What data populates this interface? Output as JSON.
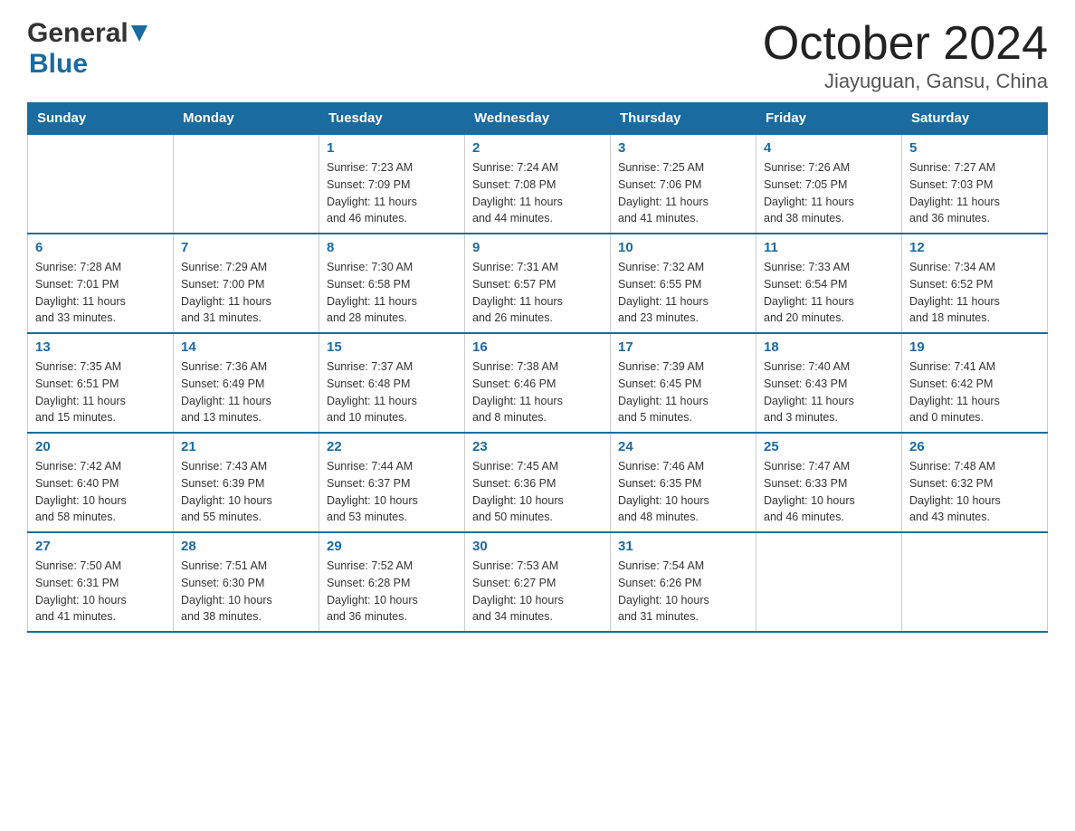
{
  "header": {
    "logo": {
      "general_text": "General",
      "blue_text": "Blue"
    },
    "title": "October 2024",
    "location": "Jiayuguan, Gansu, China"
  },
  "calendar": {
    "days_of_week": [
      "Sunday",
      "Monday",
      "Tuesday",
      "Wednesday",
      "Thursday",
      "Friday",
      "Saturday"
    ],
    "weeks": [
      [
        {
          "day": "",
          "info": ""
        },
        {
          "day": "",
          "info": ""
        },
        {
          "day": "1",
          "info": "Sunrise: 7:23 AM\nSunset: 7:09 PM\nDaylight: 11 hours\nand 46 minutes."
        },
        {
          "day": "2",
          "info": "Sunrise: 7:24 AM\nSunset: 7:08 PM\nDaylight: 11 hours\nand 44 minutes."
        },
        {
          "day": "3",
          "info": "Sunrise: 7:25 AM\nSunset: 7:06 PM\nDaylight: 11 hours\nand 41 minutes."
        },
        {
          "day": "4",
          "info": "Sunrise: 7:26 AM\nSunset: 7:05 PM\nDaylight: 11 hours\nand 38 minutes."
        },
        {
          "day": "5",
          "info": "Sunrise: 7:27 AM\nSunset: 7:03 PM\nDaylight: 11 hours\nand 36 minutes."
        }
      ],
      [
        {
          "day": "6",
          "info": "Sunrise: 7:28 AM\nSunset: 7:01 PM\nDaylight: 11 hours\nand 33 minutes."
        },
        {
          "day": "7",
          "info": "Sunrise: 7:29 AM\nSunset: 7:00 PM\nDaylight: 11 hours\nand 31 minutes."
        },
        {
          "day": "8",
          "info": "Sunrise: 7:30 AM\nSunset: 6:58 PM\nDaylight: 11 hours\nand 28 minutes."
        },
        {
          "day": "9",
          "info": "Sunrise: 7:31 AM\nSunset: 6:57 PM\nDaylight: 11 hours\nand 26 minutes."
        },
        {
          "day": "10",
          "info": "Sunrise: 7:32 AM\nSunset: 6:55 PM\nDaylight: 11 hours\nand 23 minutes."
        },
        {
          "day": "11",
          "info": "Sunrise: 7:33 AM\nSunset: 6:54 PM\nDaylight: 11 hours\nand 20 minutes."
        },
        {
          "day": "12",
          "info": "Sunrise: 7:34 AM\nSunset: 6:52 PM\nDaylight: 11 hours\nand 18 minutes."
        }
      ],
      [
        {
          "day": "13",
          "info": "Sunrise: 7:35 AM\nSunset: 6:51 PM\nDaylight: 11 hours\nand 15 minutes."
        },
        {
          "day": "14",
          "info": "Sunrise: 7:36 AM\nSunset: 6:49 PM\nDaylight: 11 hours\nand 13 minutes."
        },
        {
          "day": "15",
          "info": "Sunrise: 7:37 AM\nSunset: 6:48 PM\nDaylight: 11 hours\nand 10 minutes."
        },
        {
          "day": "16",
          "info": "Sunrise: 7:38 AM\nSunset: 6:46 PM\nDaylight: 11 hours\nand 8 minutes."
        },
        {
          "day": "17",
          "info": "Sunrise: 7:39 AM\nSunset: 6:45 PM\nDaylight: 11 hours\nand 5 minutes."
        },
        {
          "day": "18",
          "info": "Sunrise: 7:40 AM\nSunset: 6:43 PM\nDaylight: 11 hours\nand 3 minutes."
        },
        {
          "day": "19",
          "info": "Sunrise: 7:41 AM\nSunset: 6:42 PM\nDaylight: 11 hours\nand 0 minutes."
        }
      ],
      [
        {
          "day": "20",
          "info": "Sunrise: 7:42 AM\nSunset: 6:40 PM\nDaylight: 10 hours\nand 58 minutes."
        },
        {
          "day": "21",
          "info": "Sunrise: 7:43 AM\nSunset: 6:39 PM\nDaylight: 10 hours\nand 55 minutes."
        },
        {
          "day": "22",
          "info": "Sunrise: 7:44 AM\nSunset: 6:37 PM\nDaylight: 10 hours\nand 53 minutes."
        },
        {
          "day": "23",
          "info": "Sunrise: 7:45 AM\nSunset: 6:36 PM\nDaylight: 10 hours\nand 50 minutes."
        },
        {
          "day": "24",
          "info": "Sunrise: 7:46 AM\nSunset: 6:35 PM\nDaylight: 10 hours\nand 48 minutes."
        },
        {
          "day": "25",
          "info": "Sunrise: 7:47 AM\nSunset: 6:33 PM\nDaylight: 10 hours\nand 46 minutes."
        },
        {
          "day": "26",
          "info": "Sunrise: 7:48 AM\nSunset: 6:32 PM\nDaylight: 10 hours\nand 43 minutes."
        }
      ],
      [
        {
          "day": "27",
          "info": "Sunrise: 7:50 AM\nSunset: 6:31 PM\nDaylight: 10 hours\nand 41 minutes."
        },
        {
          "day": "28",
          "info": "Sunrise: 7:51 AM\nSunset: 6:30 PM\nDaylight: 10 hours\nand 38 minutes."
        },
        {
          "day": "29",
          "info": "Sunrise: 7:52 AM\nSunset: 6:28 PM\nDaylight: 10 hours\nand 36 minutes."
        },
        {
          "day": "30",
          "info": "Sunrise: 7:53 AM\nSunset: 6:27 PM\nDaylight: 10 hours\nand 34 minutes."
        },
        {
          "day": "31",
          "info": "Sunrise: 7:54 AM\nSunset: 6:26 PM\nDaylight: 10 hours\nand 31 minutes."
        },
        {
          "day": "",
          "info": ""
        },
        {
          "day": "",
          "info": ""
        }
      ]
    ]
  }
}
